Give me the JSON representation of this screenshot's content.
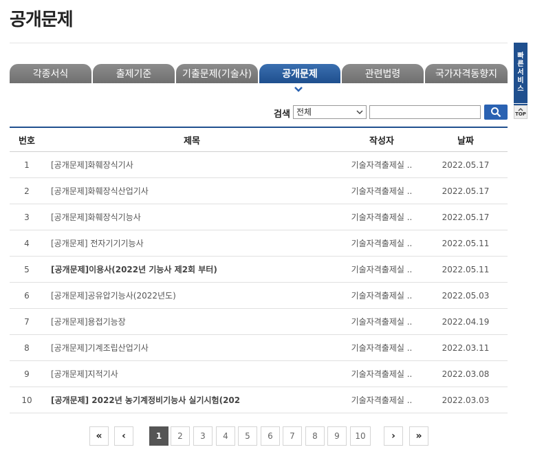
{
  "page_title": "공개문제",
  "tabs": [
    {
      "label": "각종서식",
      "active": false
    },
    {
      "label": "출제기준",
      "active": false
    },
    {
      "label": "기출문제(기술사)",
      "active": false
    },
    {
      "label": "공개문제",
      "active": true
    },
    {
      "label": "관련법령",
      "active": false
    },
    {
      "label": "국가자격동향지",
      "active": false
    }
  ],
  "search": {
    "label": "검색",
    "select_value": "전체",
    "input_value": "",
    "button_icon": "search-icon"
  },
  "table": {
    "headers": {
      "num": "번호",
      "title": "제목",
      "author": "작성자",
      "date": "날짜"
    },
    "rows": [
      {
        "num": "1",
        "title": "[공개문제]화훼장식기사",
        "author": "기술자격출제실 ..",
        "date": "2022.05.17",
        "bold": false
      },
      {
        "num": "2",
        "title": "[공개문제]화훼장식산업기사",
        "author": "기술자격출제실 ..",
        "date": "2022.05.17",
        "bold": false
      },
      {
        "num": "3",
        "title": "[공개문제]화훼장식기능사",
        "author": "기술자격출제실 ..",
        "date": "2022.05.17",
        "bold": false
      },
      {
        "num": "4",
        "title": "[공개문제] 전자기기기능사",
        "author": "기술자격출제실 ..",
        "date": "2022.05.11",
        "bold": false
      },
      {
        "num": "5",
        "title": "[공개문제]이용사(2022년 기능사 제2회 부터)",
        "author": "기술자격출제실 ..",
        "date": "2022.05.11",
        "bold": true
      },
      {
        "num": "6",
        "title": "[공개문제]공유압기능사(2022년도)",
        "author": "기술자격출제실 ..",
        "date": "2022.05.03",
        "bold": false
      },
      {
        "num": "7",
        "title": "[공개문제]용접기능장",
        "author": "기술자격출제실 ..",
        "date": "2022.04.19",
        "bold": false
      },
      {
        "num": "8",
        "title": "[공개문제]기계조립산업기사",
        "author": "기술자격출제실 ..",
        "date": "2022.03.11",
        "bold": false
      },
      {
        "num": "9",
        "title": "[공개문제]지적기사",
        "author": "기술자격출제실 ..",
        "date": "2022.03.08",
        "bold": false
      },
      {
        "num": "10",
        "title": "[공개문제] 2022년 농기계정비기능사 실기시험(202",
        "author": "기술자격출제실 ..",
        "date": "2022.03.03",
        "bold": true
      }
    ]
  },
  "pagination": {
    "first": "«",
    "prev": "‹",
    "pages": [
      "1",
      "2",
      "3",
      "4",
      "5",
      "6",
      "7",
      "8",
      "9",
      "10"
    ],
    "current": "1",
    "next": "›",
    "last": "»"
  },
  "quick_menu": {
    "label": "빠른서비스",
    "top_label": "TOP"
  },
  "colors": {
    "accent": "#1f4f8e",
    "tab_inactive": "#7d7d7d",
    "search_button": "#2a62b2"
  }
}
